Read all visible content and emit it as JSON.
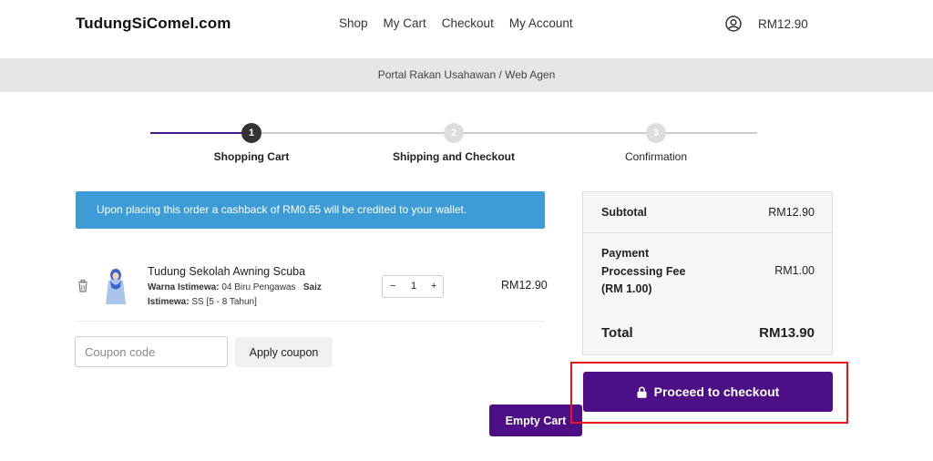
{
  "header": {
    "logo": "TudungSiComel.com",
    "nav": [
      "Shop",
      "My Cart",
      "Checkout",
      "My Account"
    ],
    "cart_total": "RM12.90"
  },
  "banner": {
    "text": "Portal Rakan Usahawan / Web Agen"
  },
  "steps": [
    {
      "number": "1",
      "label": "Shopping Cart"
    },
    {
      "number": "2",
      "label": "Shipping and Checkout"
    },
    {
      "number": "3",
      "label": "Confirmation"
    }
  ],
  "notice": "Upon placing this order a cashback of RM0.65 will be credited to your wallet.",
  "cart_item": {
    "title": "Tudung Sekolah Awning Scuba",
    "meta_label_1": "Warna Istimewa:",
    "meta_value_1": "04 Biru Pengawas",
    "meta_label_2": "Saiz Istimewa:",
    "meta_value_2": "SS [5 - 8 Tahun]",
    "quantity": "1",
    "minus": "−",
    "plus": "+",
    "price": "RM12.90"
  },
  "coupon": {
    "placeholder": "Coupon code",
    "apply_label": "Apply coupon"
  },
  "empty_cart_label": "Empty Cart",
  "summary": {
    "subtotal_label": "Subtotal",
    "subtotal_value": "RM12.90",
    "fee_label": "Payment Processing Fee (RM 1.00)",
    "fee_value": "RM1.00",
    "total_label": "Total",
    "total_value": "RM13.90"
  },
  "checkout_label": "Proceed to checkout",
  "colors": {
    "accent": "#4d0f86",
    "notice": "#3d9bd6",
    "highlight": "#e8141c"
  }
}
